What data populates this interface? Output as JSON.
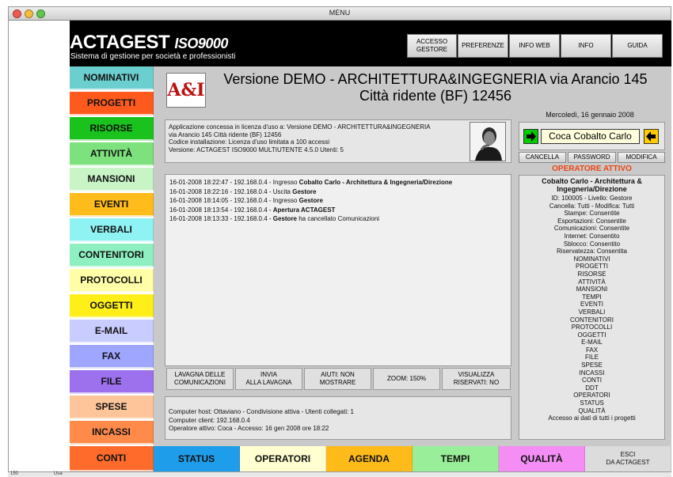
{
  "window": {
    "title": "MENU"
  },
  "app": {
    "name": "ACTAGEST",
    "name_suffix": "ISO9000",
    "subtitle": "Sistema di gestione per società e professionisti"
  },
  "header_buttons": [
    {
      "label": "ACCESSO\nGESTORE"
    },
    {
      "label": "PREFERENZE"
    },
    {
      "label": "INFO WEB"
    },
    {
      "label": "INFO"
    },
    {
      "label": "GUIDA"
    }
  ],
  "nav": [
    {
      "label": "NOMINATIVI",
      "color": "#6ccfcf"
    },
    {
      "label": "PROGETTI",
      "color": "#ff5a1e"
    },
    {
      "label": "RISORSE",
      "color": "#19c21c"
    },
    {
      "label": "ATTIVITÀ",
      "color": "#7de27d"
    },
    {
      "label": "MANSIONI",
      "color": "#c9f5c6"
    },
    {
      "label": "EVENTI",
      "color": "#ffbc1a"
    },
    {
      "label": "VERBALI",
      "color": "#8ff3f3"
    },
    {
      "label": "CONTENITORI",
      "color": "#8ef0c0"
    },
    {
      "label": "PROTOCOLLI",
      "color": "#ffffa8"
    },
    {
      "label": "OGGETTI",
      "color": "#ffef18"
    },
    {
      "label": "E-MAIL",
      "color": "#c8ccff"
    },
    {
      "label": "FAX",
      "color": "#9ea6ff"
    },
    {
      "label": "FILE",
      "color": "#9d70ee"
    },
    {
      "label": "SPESE",
      "color": "#ffc59a"
    },
    {
      "label": "INCASSI",
      "color": "#ff8a4a"
    },
    {
      "label": "CONTI",
      "color": "#ff6b2a"
    }
  ],
  "bottom_nav": [
    {
      "label": "STATUS",
      "color": "#1e9dea"
    },
    {
      "label": "OPERATORI",
      "color": "#ffffd0"
    },
    {
      "label": "AGENDA",
      "color": "#ffbb1a"
    },
    {
      "label": "TEMPI",
      "color": "#99ef99"
    },
    {
      "label": "QUALITÀ",
      "color": "#f48ef4"
    },
    {
      "label": "ESCI\nDA ACTAGEST",
      "color": "#dcdcdc"
    }
  ],
  "main": {
    "logo_text": "A&I",
    "title": "Versione DEMO - ARCHITETTURA&INGEGNERIA via Arancio 145 Città ridente (BF) 12456",
    "date": "Mercoledì, 16 gennaio 2008",
    "license_lines": [
      "Applicazione concessa in licenza d'uso a: Versione DEMO - ARCHITETTURA&INGEGNERIA",
      "via Arancio 145 Città ridente (BF) 12456",
      "Codice installazione: Licenza d'uso limitata a 100 accessi",
      "Versione: ACTAGEST ISO9000 MULTIUTENTE 4.5.0 Utenti: 5"
    ],
    "log": [
      {
        "text": "16-01-2008 18:22:47 - 192.168.0.4 - Ingresso ",
        "bold": "Cobalto Carlo - Architettura & Ingegneria/Direzione",
        "tail": ""
      },
      {
        "text": "16-01-2008 18:22:16 - 192.168.0.4 - Uscita ",
        "bold": "Gestore",
        "tail": ""
      },
      {
        "text": "16-01-2008 18:14:05 - 192.168.0.4 - Ingresso ",
        "bold": "Gestore",
        "tail": ""
      },
      {
        "text": "16-01-2008 18:13:54 - 192.168.0.4 - ",
        "bold": "Apertura ACTAGEST",
        "tail": ""
      },
      {
        "text": "16-01-2008 18:13:33 - 192.168.0.4 - ",
        "bold": "Gestore",
        "tail": " ha cancellato Comunicazioni"
      }
    ],
    "toolbar": [
      {
        "label": "LAVAGNA DELLE\nCOMUNICAZIONI"
      },
      {
        "label": "INVIA\nALLA LAVAGNA"
      },
      {
        "label": "AIUTI: NON\nMOSTRARE"
      },
      {
        "label": "ZOOM: 150%"
      },
      {
        "label": "VISUALIZZA\nRISERVATI: NO"
      }
    ],
    "info_lines": [
      "Computer host:  Ottaviano - Condivisione attiva - Utenti collegati: 1",
      "Computer client: 192.168.0.4",
      "Operatore attivo: Coca - Accesso: 16 gen 2008 ore 18:22"
    ]
  },
  "user": {
    "name": "Coca Cobalto Carlo",
    "buttons": [
      "CANCELLA",
      "PASSWORD",
      "MODIFICA"
    ],
    "status_title": "OPERATORE ATTIVO",
    "operator_name": "Cobalto Carlo - Architettura & Ingegneria/Direzione",
    "operator_lines": [
      "ID: 100005  -  Livello: Gestore",
      "Cancella: Tutti  -  Modifica: Tutti",
      "Stampe: Consentite",
      "Esportazioni: Consentite",
      "Comunicazioni: Consentite",
      "Internet: Consentito",
      "Sblocco: Consentito",
      "Riservatezza: Consentita",
      "NOMINATIVI",
      "PROGETTI",
      "RISORSE",
      "ATTIVITÀ",
      "MANSIONI",
      "TEMPI",
      "EVENTI",
      "VERBALI",
      "CONTENITORI",
      "PROTOCOLLI",
      "OGGETTI",
      "E-MAIL",
      "FAX",
      "FILE",
      "SPESE",
      "INCASSI",
      "CONTI",
      "DDT",
      "OPERATORI",
      "STATUS",
      "QUALITÀ",
      "Accesso ai dati di tutti i progetti"
    ]
  },
  "statusbar": {
    "zoom": "150",
    "mode": "Usa"
  }
}
